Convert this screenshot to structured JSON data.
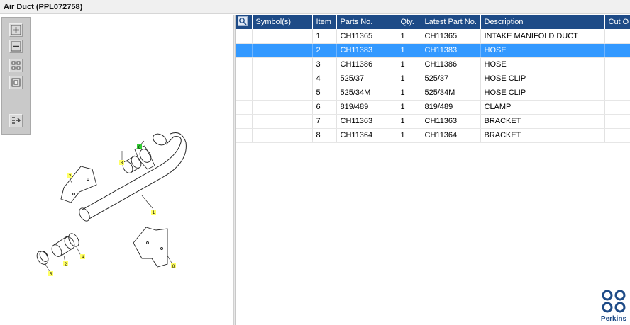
{
  "window": {
    "title": "Air Duct (PPL072758)"
  },
  "toolbar": {
    "buttons": [
      {
        "name": "zoom-in",
        "icon": "zoom-in-icon"
      },
      {
        "name": "zoom-out",
        "icon": "zoom-out-icon"
      },
      {
        "name": "fit-all",
        "icon": "fit-all-icon"
      },
      {
        "name": "fit-window",
        "icon": "fit-window-icon"
      },
      {
        "name": "export",
        "icon": "export-icon"
      }
    ]
  },
  "diagram": {
    "callouts": [
      "1",
      "2",
      "3",
      "4",
      "5",
      "6",
      "7",
      "8"
    ],
    "callout_color": "#ffff66",
    "active_callout_color": "#33cc33"
  },
  "table": {
    "columns": [
      "",
      "Symbol(s)",
      "Item",
      "Parts No.",
      "Qty.",
      "Latest Part No.",
      "Description",
      "Cut O"
    ],
    "header_color": "#1e4b87",
    "selection_color": "#3399ff",
    "rows": [
      {
        "item": "1",
        "part_no": "CH11365",
        "qty": "1",
        "latest": "CH11365",
        "desc": "INTAKE MANIFOLD DUCT",
        "selected": false
      },
      {
        "item": "2",
        "part_no": "CH11383",
        "qty": "1",
        "latest": "CH11383",
        "desc": "HOSE",
        "selected": true
      },
      {
        "item": "3",
        "part_no": "CH11386",
        "qty": "1",
        "latest": "CH11386",
        "desc": "HOSE",
        "selected": false
      },
      {
        "item": "4",
        "part_no": "525/37",
        "qty": "1",
        "latest": "525/37",
        "desc": "HOSE CLIP",
        "selected": false
      },
      {
        "item": "5",
        "part_no": "525/34M",
        "qty": "1",
        "latest": "525/34M",
        "desc": "HOSE CLIP",
        "selected": false
      },
      {
        "item": "6",
        "part_no": "819/489",
        "qty": "1",
        "latest": "819/489",
        "desc": "CLAMP",
        "selected": false
      },
      {
        "item": "7",
        "part_no": "CH11363",
        "qty": "1",
        "latest": "CH11363",
        "desc": "BRACKET",
        "selected": false
      },
      {
        "item": "8",
        "part_no": "CH11364",
        "qty": "1",
        "latest": "CH11364",
        "desc": "BRACKET",
        "selected": false
      }
    ]
  },
  "brand": {
    "name": "Perkins",
    "color": "#1e4b87"
  }
}
